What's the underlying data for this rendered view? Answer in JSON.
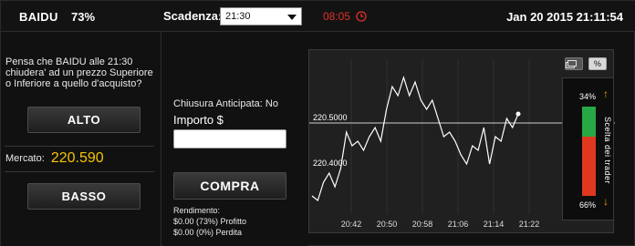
{
  "header": {
    "symbol": "BAIDU",
    "payout_pct": "73%",
    "expiry_label": "Scadenza:",
    "expiry_value": "21:30",
    "countdown": "08:05",
    "datetime": "Jan 20 2015  21:11:54"
  },
  "left": {
    "question": "Pensa che BAIDU alle 21:30 chiudera' ad un prezzo Superiore o Inferiore a quello d'acquisto?",
    "alto_label": "ALTO",
    "market_label": "Mercato:",
    "market_value": "220.590",
    "basso_label": "BASSO"
  },
  "middle": {
    "early_close": "Chiusura Anticipata: No",
    "amount_label": "Importo $",
    "amount_value": "",
    "buy_label": "COMPRA",
    "returns_title": "Rendimento:",
    "profit_line": "$0.00 (73%) Profitto",
    "loss_line": "$0.00 (0%) Perdita"
  },
  "chart_data": {
    "type": "line",
    "x": [
      "20:35",
      "20:36",
      "20:37",
      "20:38",
      "20:39",
      "20:40",
      "20:41",
      "20:42",
      "20:43",
      "20:44",
      "20:45",
      "20:46",
      "20:47",
      "20:48",
      "20:49",
      "20:50",
      "20:51",
      "20:52",
      "20:53",
      "20:54",
      "20:55",
      "20:56",
      "20:57",
      "20:58",
      "20:59",
      "21:00",
      "21:01",
      "21:02",
      "21:03",
      "21:04",
      "21:05",
      "21:06",
      "21:07",
      "21:08",
      "21:09",
      "21:10",
      "21:11"
    ],
    "values": [
      220.34,
      220.33,
      220.37,
      220.39,
      220.36,
      220.4,
      220.48,
      220.45,
      220.46,
      220.44,
      220.47,
      220.49,
      220.46,
      220.53,
      220.58,
      220.56,
      220.6,
      220.56,
      220.59,
      220.55,
      220.53,
      220.55,
      220.51,
      220.47,
      220.48,
      220.46,
      220.43,
      220.41,
      220.45,
      220.44,
      220.49,
      220.41,
      220.47,
      220.46,
      220.51,
      220.49,
      220.52
    ],
    "reference_lines": [
      {
        "label": "220.5000",
        "value": 220.5
      },
      {
        "label": "220.4000",
        "value": 220.4
      }
    ],
    "x_ticks": [
      "20:42",
      "20:50",
      "20:58",
      "21:06",
      "21:14",
      "21:22"
    ],
    "ylim": [
      220.3,
      220.64
    ]
  },
  "chart_controls": {
    "btn_a": "",
    "btn_b": "%"
  },
  "sentiment": {
    "title": "Scelta dei trader",
    "up_pct": "34%",
    "down_pct": "66%",
    "up_frac": 0.34,
    "down_frac": 0.66
  },
  "colors": {
    "accent_yellow": "#f5c400",
    "countdown_red": "#e0312b",
    "bull_green": "#27a845",
    "bear_red": "#e0381f"
  }
}
